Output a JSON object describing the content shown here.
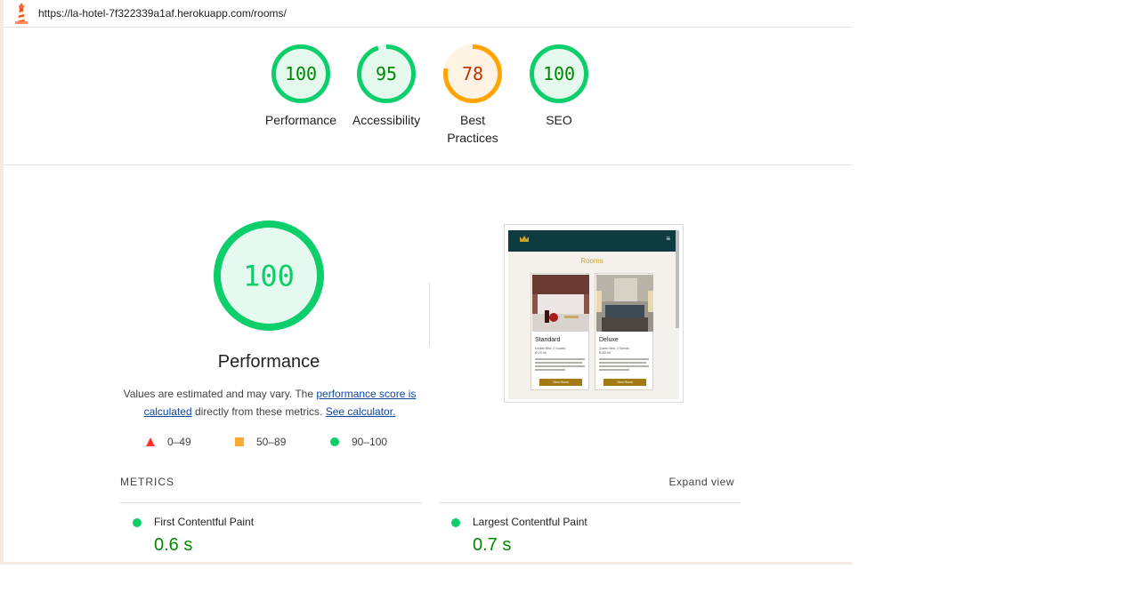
{
  "url": "https://la-hotel-7f322339a1af.herokuapp.com/rooms/",
  "colors": {
    "pass": "#0cce6b",
    "pass_text": "#008800",
    "average": "#ffa400",
    "average_text": "#c33300",
    "fail": "#ff3333"
  },
  "categories": [
    {
      "label": "Performance",
      "score": "100",
      "value": 100,
      "rating": "pass"
    },
    {
      "label": "Accessibility",
      "score": "95",
      "value": 95,
      "rating": "pass"
    },
    {
      "label": "Best Practices",
      "score": "78",
      "value": 78,
      "rating": "average"
    },
    {
      "label": "SEO",
      "score": "100",
      "value": 100,
      "rating": "pass"
    }
  ],
  "performance": {
    "score": "100",
    "value": 100,
    "title": "Performance",
    "desc_pre": "Values are estimated and may vary. The ",
    "desc_link": "performance score is calculated",
    "desc_mid": " directly from these metrics. ",
    "desc_calc": "See calculator."
  },
  "legend": [
    {
      "label": "0–49",
      "shape": "triangle"
    },
    {
      "label": "50–89",
      "shape": "square"
    },
    {
      "label": "90–100",
      "shape": "circle"
    }
  ],
  "thumbnail": {
    "heading": "Rooms",
    "menu_icon": "≡",
    "cards": [
      {
        "title": "Standard",
        "sub1": "Double Bed, 2 Guests",
        "sub2": "€120.00",
        "button": "View Room"
      },
      {
        "title": "Deluxe",
        "sub1": "Queen Bed, 2 Guests",
        "sub2": "€150.00",
        "button": "View Room"
      }
    ]
  },
  "metrics": {
    "label": "METRICS",
    "expand": "Expand view",
    "items": [
      {
        "name": "First Contentful Paint",
        "value": "0.6 s"
      },
      {
        "name": "Largest Contentful Paint",
        "value": "0.7 s"
      }
    ]
  }
}
